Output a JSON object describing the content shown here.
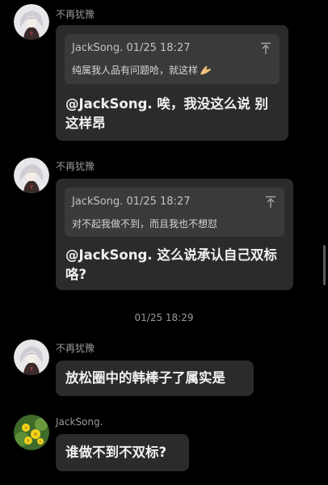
{
  "messages": [
    {
      "sender": "不再犹豫",
      "avatar": "anime-girl-avatar",
      "quote": {
        "author_time": "JackSong. 01/25 18:27",
        "text": "纯属我人品有问题哈，就这样",
        "emoji": "folded-hands-icon"
      },
      "text": "@JackSong. 唉，我没这么说 别这样昂"
    },
    {
      "sender": "不再犹豫",
      "avatar": "anime-girl-avatar",
      "quote": {
        "author_time": "JackSong. 01/25 18:27",
        "text": "对不起我做不到，而且我也不想怼"
      },
      "text": "@JackSong. 这么说承认自己双标咯?"
    },
    {
      "timestamp": "01/25 18:29"
    },
    {
      "sender": "不再犹豫",
      "avatar": "anime-girl-avatar",
      "text": "放松圈中的韩棒子了属实是"
    },
    {
      "sender": "JackSong.",
      "avatar": "yellow-flowers-avatar",
      "text": "谁做不到不双标?"
    }
  ],
  "colors": {
    "background": "#000000",
    "bubble": "#2b2b2b",
    "quote": "#3a3a3a",
    "text": "#f0f0f0",
    "meta": "#9a9a9a"
  }
}
